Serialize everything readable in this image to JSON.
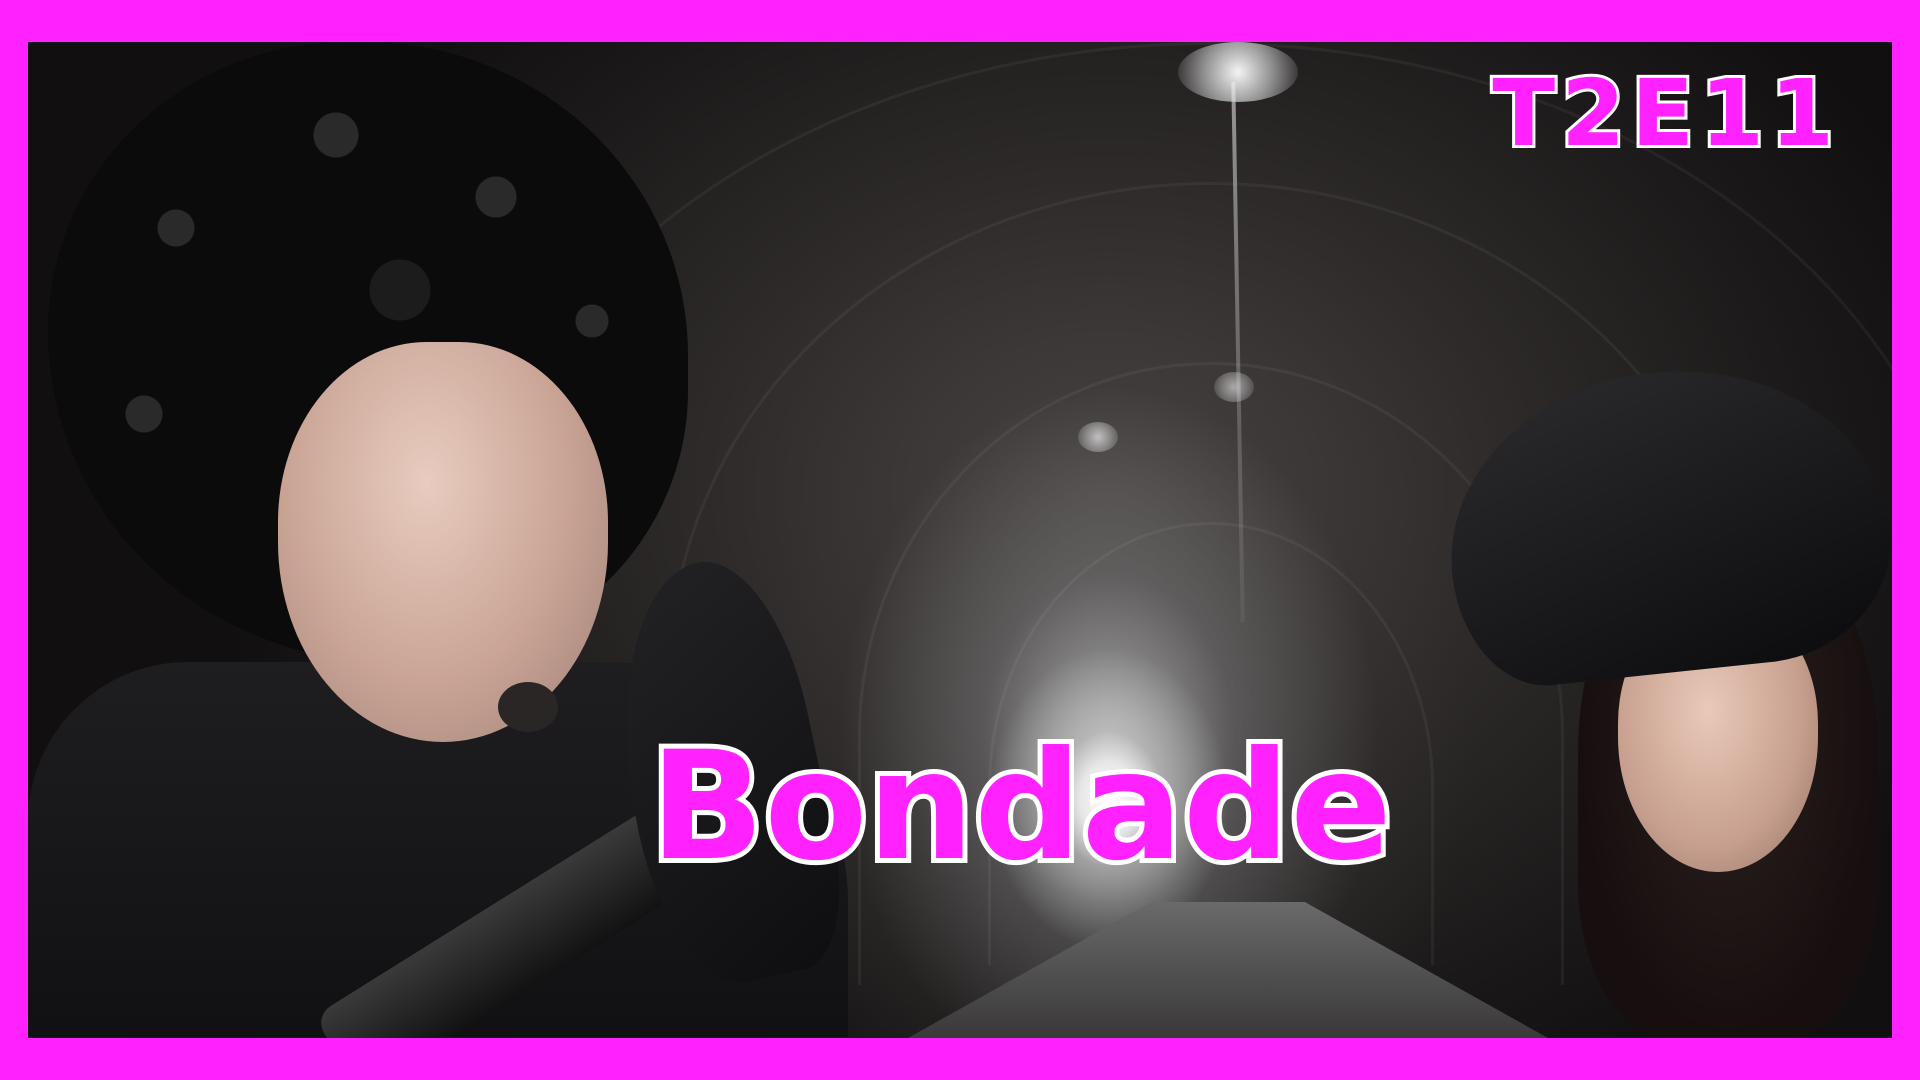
{
  "thumbnail": {
    "episode_code": "T2E11",
    "title": "Bondade",
    "colors": {
      "frame": "#ff22ff",
      "text_fill": "#ff22ff",
      "text_stroke": "#ffffff"
    }
  }
}
